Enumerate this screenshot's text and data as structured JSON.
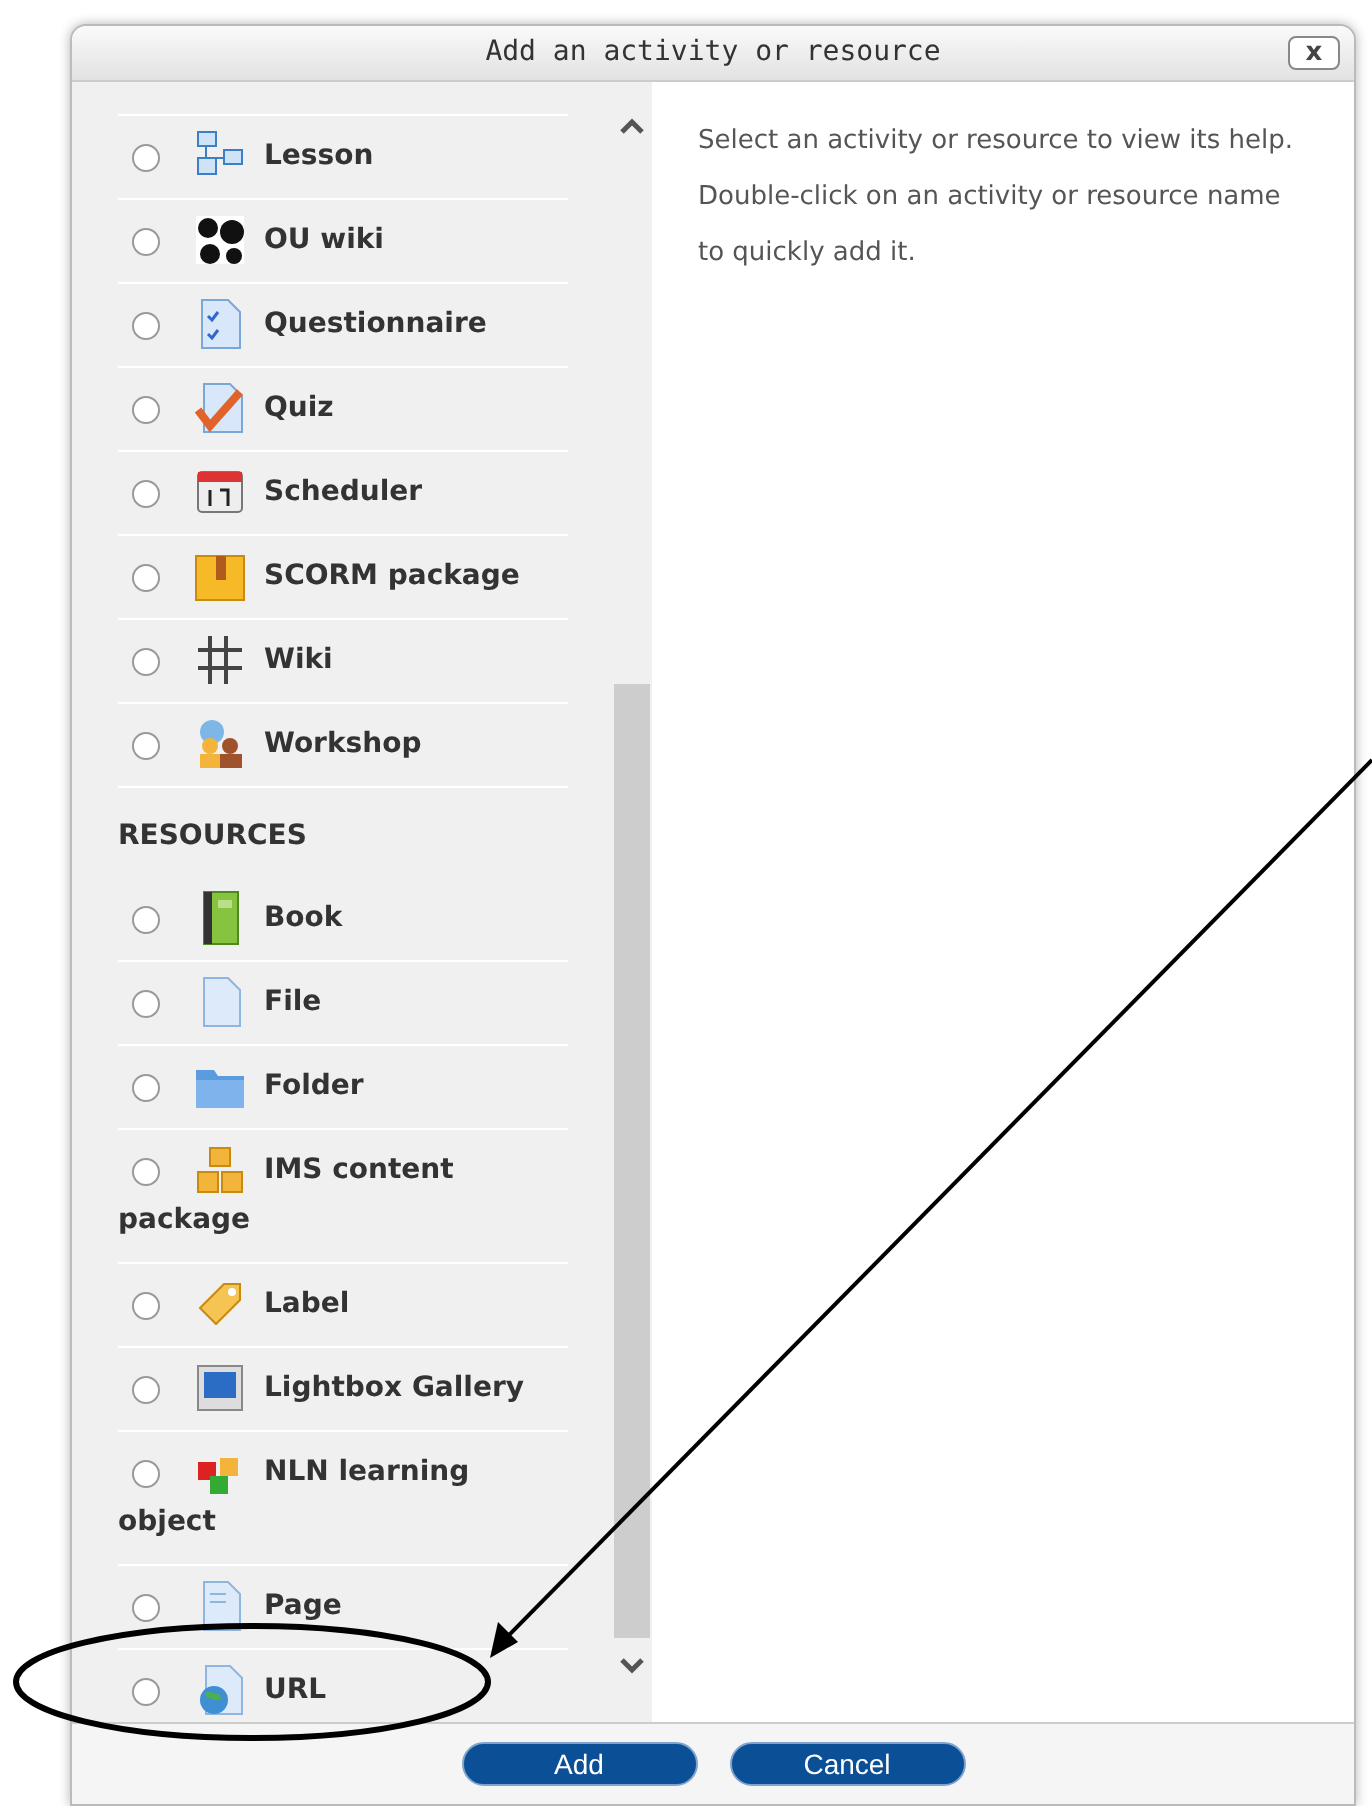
{
  "dialog": {
    "title": "Add an activity or resource",
    "close_label": "x"
  },
  "sections": [
    {
      "items": [
        {
          "label": "Lesson",
          "selected": false
        },
        {
          "label": "OU wiki",
          "selected": false
        },
        {
          "label": "Questionnaire",
          "selected": false
        },
        {
          "label": "Quiz",
          "selected": false
        },
        {
          "label": "Scheduler",
          "selected": false
        },
        {
          "label": "SCORM package",
          "selected": false
        },
        {
          "label": "Wiki",
          "selected": false
        },
        {
          "label": "Workshop",
          "selected": false
        }
      ]
    },
    {
      "heading": "RESOURCES",
      "items": [
        {
          "label": "Book",
          "selected": false
        },
        {
          "label": "File",
          "selected": false
        },
        {
          "label": "Folder",
          "selected": false
        },
        {
          "label": "IMS content package",
          "selected": false
        },
        {
          "label": "Label",
          "selected": false
        },
        {
          "label": "Lightbox Gallery",
          "selected": false
        },
        {
          "label": "NLN learning object",
          "selected": false
        },
        {
          "label": "Page",
          "selected": false
        },
        {
          "label": "URL",
          "selected": false
        }
      ]
    }
  ],
  "help_text": "Select an activity or resource to view its help. Double-click on an activity or resource name to quickly add it.",
  "buttons": [
    "Add",
    "Cancel"
  ]
}
